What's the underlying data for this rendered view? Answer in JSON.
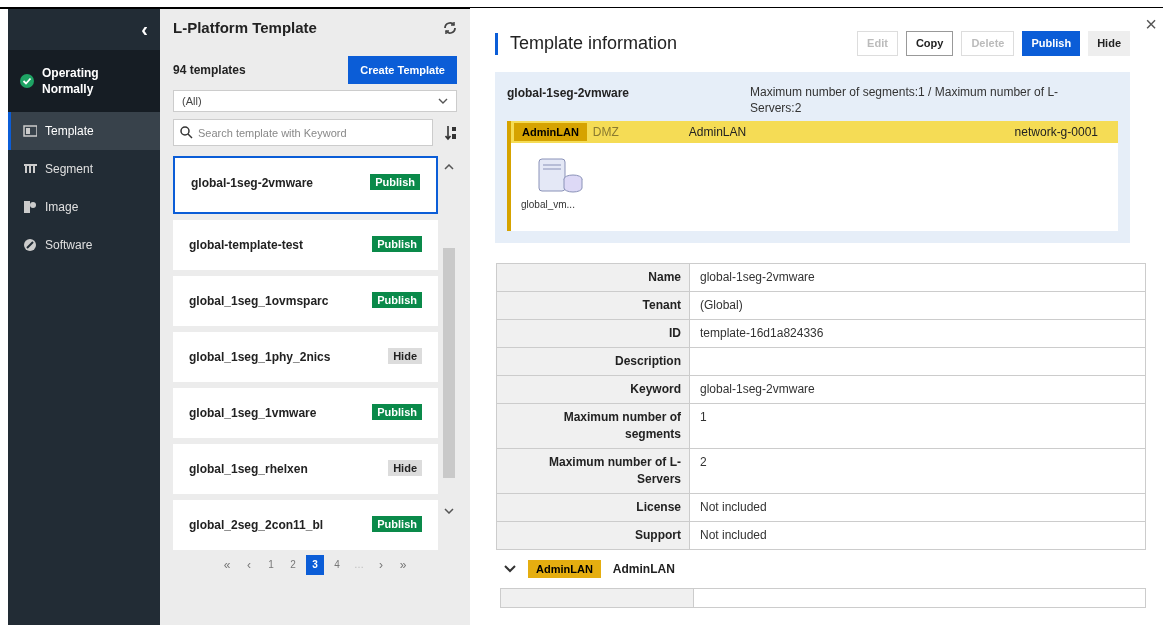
{
  "sidebar": {
    "collapse": "‹",
    "status": {
      "label": "Operating Normally",
      "ok": true
    },
    "items": [
      {
        "label": "Template",
        "selected": true
      },
      {
        "label": "Segment",
        "selected": false
      },
      {
        "label": "Image",
        "selected": false
      },
      {
        "label": "Software",
        "selected": false
      }
    ]
  },
  "list_panel": {
    "title": "L-Platform Template",
    "count": "94 templates",
    "create_button": "Create Template",
    "filter": {
      "value": "(All)"
    },
    "search": {
      "placeholder": "Search template with Keyword"
    },
    "templates": [
      {
        "name": "global-1seg-2vmware",
        "badge": "Publish",
        "kind": "publish",
        "selected": true
      },
      {
        "name": "global-template-test",
        "badge": "Publish",
        "kind": "publish",
        "selected": false
      },
      {
        "name": "global_1seg_1ovmsparc",
        "badge": "Publish",
        "kind": "publish",
        "selected": false
      },
      {
        "name": "global_1seg_1phy_2nics",
        "badge": "Hide",
        "kind": "hide",
        "selected": false
      },
      {
        "name": "global_1seg_1vmware",
        "badge": "Publish",
        "kind": "publish",
        "selected": false
      },
      {
        "name": "global_1seg_rhelxen",
        "badge": "Hide",
        "kind": "hide",
        "selected": false
      },
      {
        "name": "global_2seg_2con11_bl",
        "badge": "Publish",
        "kind": "publish",
        "selected": false
      }
    ],
    "pagination": [
      {
        "label": "«",
        "kind": "nav",
        "selected": false
      },
      {
        "label": "‹",
        "kind": "nav",
        "selected": false
      },
      {
        "label": "1",
        "kind": "page",
        "selected": false
      },
      {
        "label": "2",
        "kind": "page",
        "selected": false
      },
      {
        "label": "3",
        "kind": "page",
        "selected": true
      },
      {
        "label": "4",
        "kind": "page",
        "selected": false
      },
      {
        "label": "…",
        "kind": "gap",
        "selected": false
      },
      {
        "label": "›",
        "kind": "nav",
        "selected": false
      },
      {
        "label": "»",
        "kind": "nav",
        "selected": false
      }
    ]
  },
  "detail": {
    "title": "Template information",
    "close": "×",
    "buttons": [
      {
        "label": "Edit",
        "kind": "outline",
        "disabled": true
      },
      {
        "label": "Copy",
        "kind": "outline",
        "disabled": false
      },
      {
        "label": "Delete",
        "kind": "outline",
        "disabled": true
      },
      {
        "label": "Publish",
        "kind": "primary",
        "disabled": false
      },
      {
        "label": "Hide",
        "kind": "plain",
        "disabled": false
      }
    ],
    "summary": {
      "name": "global-1seg-2vmware",
      "limits": "Maximum number of segments:1 / Maximum number of L-Servers:2",
      "segment": {
        "tag": "AdminLAN",
        "type": "DMZ",
        "name": "AdminLAN",
        "network": "network-g-0001"
      },
      "server_label": "global_vm..."
    },
    "properties": [
      {
        "label": "Name",
        "value": "global-1seg-2vmware"
      },
      {
        "label": "Tenant",
        "value": "(Global)"
      },
      {
        "label": "ID",
        "value": "template-16d1a824336"
      },
      {
        "label": "Description"
      },
      {
        "label": "Keyword",
        "value": "global-1seg-2vmware"
      },
      {
        "label": "Maximum number of segments",
        "value": "1"
      },
      {
        "label": "Maximum number of L-Servers",
        "value": "2"
      },
      {
        "label": "License",
        "value": "Not included"
      },
      {
        "label": "Support",
        "value": "Not included"
      }
    ],
    "section": {
      "expanded": true,
      "tag": "AdminLAN",
      "label": "AdminLAN"
    }
  }
}
